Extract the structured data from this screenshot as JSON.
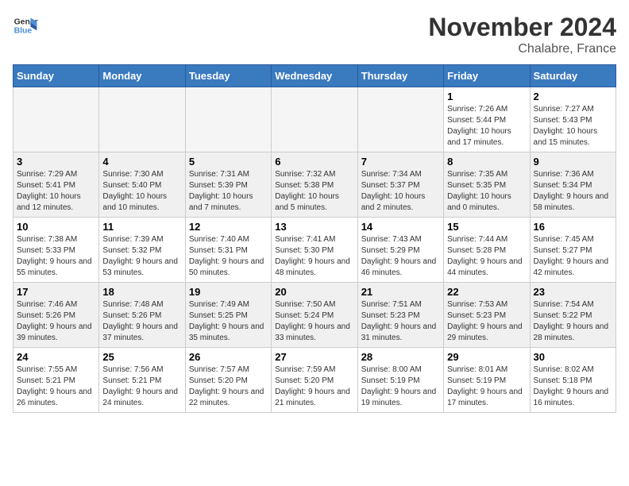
{
  "logo": {
    "line1": "General",
    "line2": "Blue"
  },
  "title": "November 2024",
  "location": "Chalabre, France",
  "days": [
    "Sunday",
    "Monday",
    "Tuesday",
    "Wednesday",
    "Thursday",
    "Friday",
    "Saturday"
  ],
  "weeks": [
    [
      {
        "date": "",
        "info": ""
      },
      {
        "date": "",
        "info": ""
      },
      {
        "date": "",
        "info": ""
      },
      {
        "date": "",
        "info": ""
      },
      {
        "date": "",
        "info": ""
      },
      {
        "date": "1",
        "info": "Sunrise: 7:26 AM\nSunset: 5:44 PM\nDaylight: 10 hours and 17 minutes."
      },
      {
        "date": "2",
        "info": "Sunrise: 7:27 AM\nSunset: 5:43 PM\nDaylight: 10 hours and 15 minutes."
      }
    ],
    [
      {
        "date": "3",
        "info": "Sunrise: 7:29 AM\nSunset: 5:41 PM\nDaylight: 10 hours and 12 minutes."
      },
      {
        "date": "4",
        "info": "Sunrise: 7:30 AM\nSunset: 5:40 PM\nDaylight: 10 hours and 10 minutes."
      },
      {
        "date": "5",
        "info": "Sunrise: 7:31 AM\nSunset: 5:39 PM\nDaylight: 10 hours and 7 minutes."
      },
      {
        "date": "6",
        "info": "Sunrise: 7:32 AM\nSunset: 5:38 PM\nDaylight: 10 hours and 5 minutes."
      },
      {
        "date": "7",
        "info": "Sunrise: 7:34 AM\nSunset: 5:37 PM\nDaylight: 10 hours and 2 minutes."
      },
      {
        "date": "8",
        "info": "Sunrise: 7:35 AM\nSunset: 5:35 PM\nDaylight: 10 hours and 0 minutes."
      },
      {
        "date": "9",
        "info": "Sunrise: 7:36 AM\nSunset: 5:34 PM\nDaylight: 9 hours and 58 minutes."
      }
    ],
    [
      {
        "date": "10",
        "info": "Sunrise: 7:38 AM\nSunset: 5:33 PM\nDaylight: 9 hours and 55 minutes."
      },
      {
        "date": "11",
        "info": "Sunrise: 7:39 AM\nSunset: 5:32 PM\nDaylight: 9 hours and 53 minutes."
      },
      {
        "date": "12",
        "info": "Sunrise: 7:40 AM\nSunset: 5:31 PM\nDaylight: 9 hours and 50 minutes."
      },
      {
        "date": "13",
        "info": "Sunrise: 7:41 AM\nSunset: 5:30 PM\nDaylight: 9 hours and 48 minutes."
      },
      {
        "date": "14",
        "info": "Sunrise: 7:43 AM\nSunset: 5:29 PM\nDaylight: 9 hours and 46 minutes."
      },
      {
        "date": "15",
        "info": "Sunrise: 7:44 AM\nSunset: 5:28 PM\nDaylight: 9 hours and 44 minutes."
      },
      {
        "date": "16",
        "info": "Sunrise: 7:45 AM\nSunset: 5:27 PM\nDaylight: 9 hours and 42 minutes."
      }
    ],
    [
      {
        "date": "17",
        "info": "Sunrise: 7:46 AM\nSunset: 5:26 PM\nDaylight: 9 hours and 39 minutes."
      },
      {
        "date": "18",
        "info": "Sunrise: 7:48 AM\nSunset: 5:26 PM\nDaylight: 9 hours and 37 minutes."
      },
      {
        "date": "19",
        "info": "Sunrise: 7:49 AM\nSunset: 5:25 PM\nDaylight: 9 hours and 35 minutes."
      },
      {
        "date": "20",
        "info": "Sunrise: 7:50 AM\nSunset: 5:24 PM\nDaylight: 9 hours and 33 minutes."
      },
      {
        "date": "21",
        "info": "Sunrise: 7:51 AM\nSunset: 5:23 PM\nDaylight: 9 hours and 31 minutes."
      },
      {
        "date": "22",
        "info": "Sunrise: 7:53 AM\nSunset: 5:23 PM\nDaylight: 9 hours and 29 minutes."
      },
      {
        "date": "23",
        "info": "Sunrise: 7:54 AM\nSunset: 5:22 PM\nDaylight: 9 hours and 28 minutes."
      }
    ],
    [
      {
        "date": "24",
        "info": "Sunrise: 7:55 AM\nSunset: 5:21 PM\nDaylight: 9 hours and 26 minutes."
      },
      {
        "date": "25",
        "info": "Sunrise: 7:56 AM\nSunset: 5:21 PM\nDaylight: 9 hours and 24 minutes."
      },
      {
        "date": "26",
        "info": "Sunrise: 7:57 AM\nSunset: 5:20 PM\nDaylight: 9 hours and 22 minutes."
      },
      {
        "date": "27",
        "info": "Sunrise: 7:59 AM\nSunset: 5:20 PM\nDaylight: 9 hours and 21 minutes."
      },
      {
        "date": "28",
        "info": "Sunrise: 8:00 AM\nSunset: 5:19 PM\nDaylight: 9 hours and 19 minutes."
      },
      {
        "date": "29",
        "info": "Sunrise: 8:01 AM\nSunset: 5:19 PM\nDaylight: 9 hours and 17 minutes."
      },
      {
        "date": "30",
        "info": "Sunrise: 8:02 AM\nSunset: 5:18 PM\nDaylight: 9 hours and 16 minutes."
      }
    ]
  ]
}
